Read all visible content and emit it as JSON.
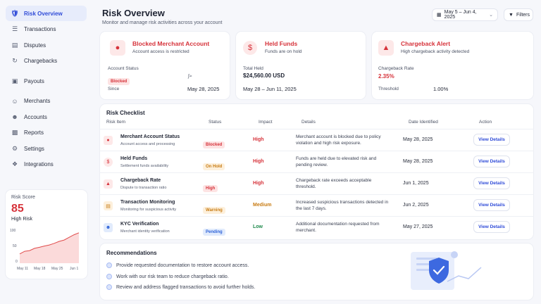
{
  "sidebar": {
    "items": [
      {
        "label": "Risk Overview",
        "icon": "shield-icon",
        "active": true
      },
      {
        "label": "Transactions",
        "icon": "list-icon"
      },
      {
        "label": "Disputes",
        "icon": "document-icon"
      },
      {
        "label": "Chargebacks",
        "icon": "refresh-icon"
      },
      {
        "label": "Payouts",
        "icon": "wallet-icon"
      },
      {
        "label": "Merchants",
        "icon": "users-icon"
      },
      {
        "label": "Accounts",
        "icon": "user-icon"
      },
      {
        "label": "Reports",
        "icon": "chart-icon"
      },
      {
        "label": "Settings",
        "icon": "gear-icon"
      },
      {
        "label": "Integrations",
        "icon": "puzzle-icon"
      }
    ]
  },
  "score": {
    "label": "Risk Score",
    "value": "85",
    "level": "High Risk",
    "chart_data": {
      "type": "area",
      "x": [
        "May 11",
        "May 18",
        "May 25",
        "Jun 1"
      ],
      "y_ticks": [
        "100",
        "50",
        "0"
      ],
      "ylim": [
        0,
        100
      ],
      "values": [
        28,
        36,
        38,
        45,
        48,
        52,
        55,
        60,
        66,
        70,
        78,
        86,
        92
      ],
      "color": "#e04b4b"
    }
  },
  "header": {
    "title": "Risk Overview",
    "subtitle": "Monitor and manage risk activities across your account",
    "date_range": "May 5 – Jun 4, 2025",
    "filters_label": "Filters"
  },
  "cards": {
    "blocked": {
      "title": "Blocked Merchant Account",
      "desc": "Account access is restricted",
      "k1": "Account Status",
      "badge": "Blocked",
      "k2": "Since",
      "v2": "May 28, 2025"
    },
    "held": {
      "title": "Held Funds",
      "desc": "Funds are on hold",
      "k1": "Total Held",
      "v1": "$24,560.00 USD",
      "v2": "May 28 – Jun 11, 2025"
    },
    "chargeback": {
      "title": "Chargeback Alert",
      "desc": "High chargeback activity detected",
      "k1": "Chargeback Rate",
      "v1": "2.35%",
      "k2": "Threshold",
      "v2": "1.00%"
    }
  },
  "checklist": {
    "title": "Risk Checklist",
    "headers": [
      "Risk Item",
      "Status",
      "Impact",
      "Details",
      "Date Identified",
      "Action"
    ],
    "rows": [
      {
        "name": "Merchant Account Status",
        "sub": "Account access and processing",
        "status": "Blocked",
        "impact": "High",
        "details": "Merchant account is blocked due to policy violation and high risk exposure.",
        "date": "May 28, 2025",
        "action": "View Details"
      },
      {
        "name": "Held Funds",
        "sub": "Settlement funds availability",
        "status": "On Hold",
        "impact": "High",
        "details": "Funds are held due to elevated risk and pending review.",
        "date": "May 28, 2025",
        "action": "View Details"
      },
      {
        "name": "Chargeback Rate",
        "sub": "Dispute to transaction ratio",
        "status": "High",
        "impact": "High",
        "details": "Chargeback rate exceeds acceptable threshold.",
        "date": "Jun 1, 2025",
        "action": "View Details"
      },
      {
        "name": "Transaction Monitoring",
        "sub": "Monitoring for suspicious activity",
        "status": "Warning",
        "impact": "Medium",
        "details": "Increased suspicious transactions detected in the last 7 days.",
        "date": "Jun 2, 2025",
        "action": "View Details"
      },
      {
        "name": "KYC Verification",
        "sub": "Merchant identity verification",
        "status": "Pending",
        "impact": "Low",
        "details": "Additional documentation requested from merchant.",
        "date": "May 27, 2025",
        "action": "View Details"
      }
    ]
  },
  "recommendations": {
    "title": "Recommendations",
    "items": [
      "Provide requested documentation to restore account access.",
      "Work with our risk team to reduce chargeback ratio.",
      "Review and address flagged transactions to avoid further holds."
    ]
  },
  "colors": {
    "accent": "#2f4bd8",
    "danger": "#d6323a",
    "warning": "#c87b12",
    "success": "#1f8a4c"
  }
}
